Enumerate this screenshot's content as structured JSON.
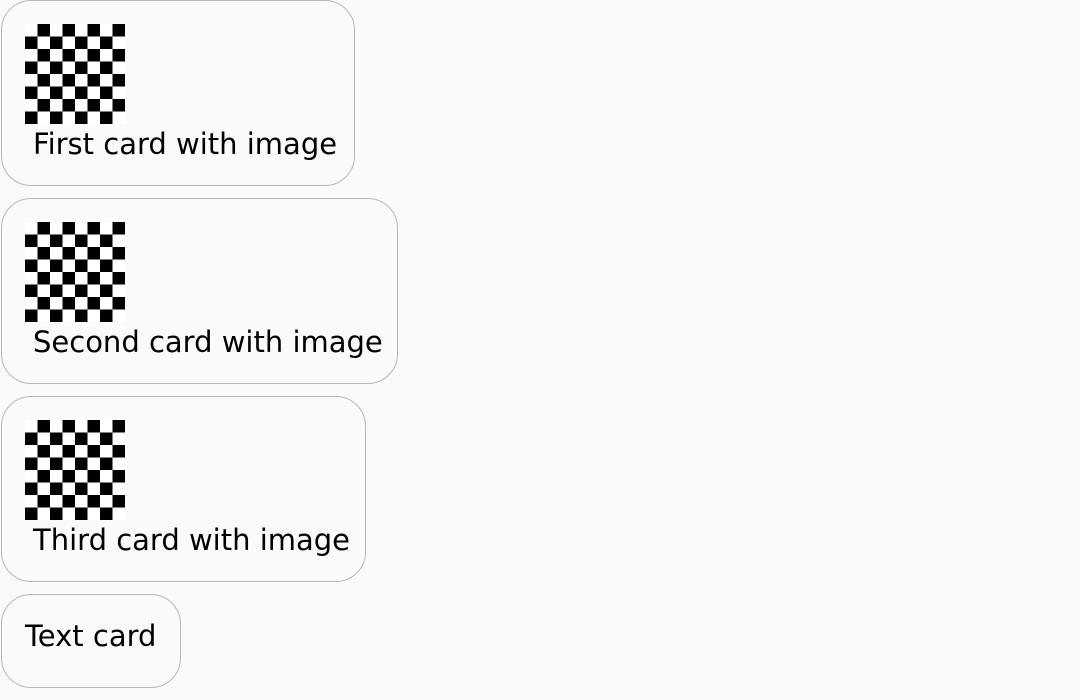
{
  "cards": [
    {
      "type": "image",
      "text": "First card with image"
    },
    {
      "type": "image",
      "text": "Second card with image"
    },
    {
      "type": "image",
      "text": "Third card with image"
    },
    {
      "type": "text",
      "text": "Text card"
    }
  ]
}
